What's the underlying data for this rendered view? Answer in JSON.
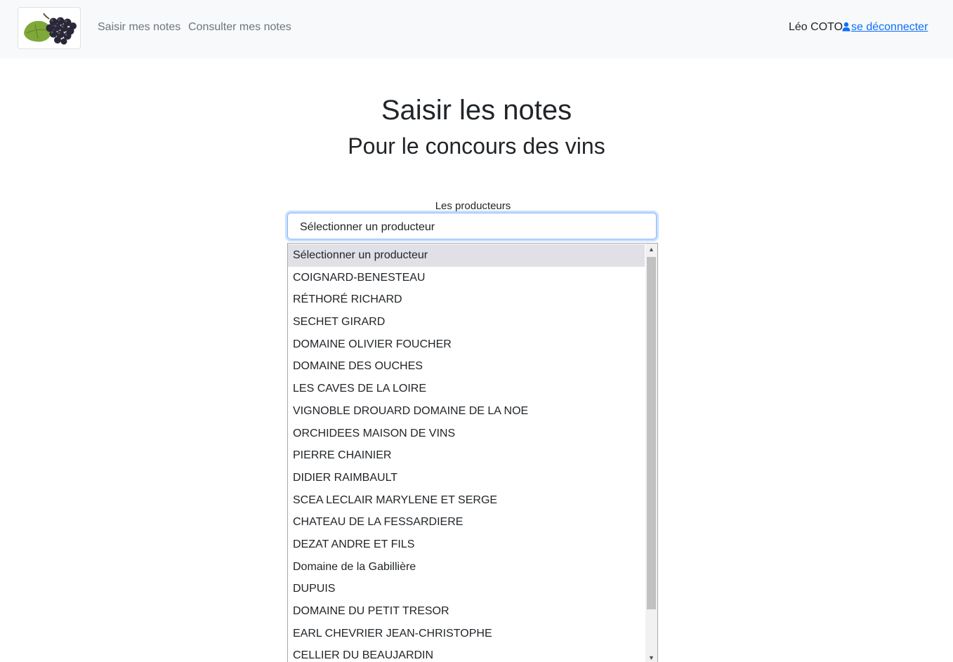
{
  "navbar": {
    "logo_alt": "grape-logo",
    "links": [
      {
        "label": "Saisir mes notes"
      },
      {
        "label": "Consulter mes notes"
      }
    ],
    "user_name": "Léo COTO",
    "logout_label": "se déconnecter",
    "logout_icon": "user-icon"
  },
  "main": {
    "title": "Saisir les notes",
    "subtitle": "Pour le concours des vins",
    "producer_label": "Les producteurs",
    "select_value": "Sélectionner un producteur",
    "options": [
      "Sélectionner un producteur",
      "COIGNARD-BENESTEAU",
      "RÉTHORÉ RICHARD",
      "SECHET GIRARD",
      "DOMAINE OLIVIER FOUCHER",
      "DOMAINE DES OUCHES",
      "LES CAVES DE LA LOIRE",
      "VIGNOBLE DROUARD DOMAINE DE LA NOE",
      "ORCHIDEES MAISON DE VINS",
      "PIERRE CHAINIER",
      "DIDIER RAIMBAULT",
      "SCEA LECLAIR MARYLENE ET SERGE",
      "CHATEAU DE LA FESSARDIERE",
      "DEZAT ANDRE ET FILS",
      "Domaine de la Gabillière",
      "DUPUIS",
      "DOMAINE DU PETIT TRESOR",
      "EARL CHEVRIER JEAN-CHRISTOPHE",
      "CELLIER DU BEAUJARDIN"
    ]
  },
  "colors": {
    "navbar_bg": "#f8f9fa",
    "link_muted": "#6c757d",
    "link_primary": "#0d6efd",
    "focus_border": "#86b7fe",
    "option_selected_bg": "#e0e0e6"
  }
}
